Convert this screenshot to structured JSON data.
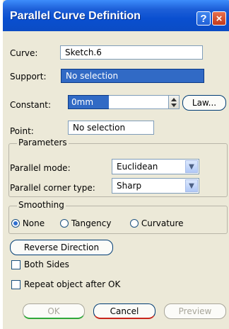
{
  "window": {
    "title": "Parallel Curve Definition"
  },
  "titlebar": {
    "help": "?",
    "close": "×"
  },
  "curve": {
    "label": "Curve:",
    "value": "Sketch.6"
  },
  "support": {
    "label": "Support:",
    "value": "No selection"
  },
  "constant": {
    "label": "Constant:",
    "value": "0mm",
    "law_button": "Law..."
  },
  "point": {
    "label": "Point:",
    "value": "No selection"
  },
  "parameters": {
    "title": "Parameters",
    "mode_label": "Parallel mode:",
    "mode_value": "Euclidean",
    "corner_label": "Parallel corner type:",
    "corner_value": "Sharp"
  },
  "smoothing": {
    "title": "Smoothing",
    "options": [
      "None",
      "Tangency",
      "Curvature"
    ],
    "selected": "None"
  },
  "reverse_button": "Reverse Direction",
  "both_sides": {
    "label": "Both Sides",
    "checked": false
  },
  "repeat": {
    "label": "Repeat object after OK",
    "checked": false
  },
  "buttons": {
    "ok": "OK",
    "cancel": "Cancel",
    "preview": "Preview"
  }
}
